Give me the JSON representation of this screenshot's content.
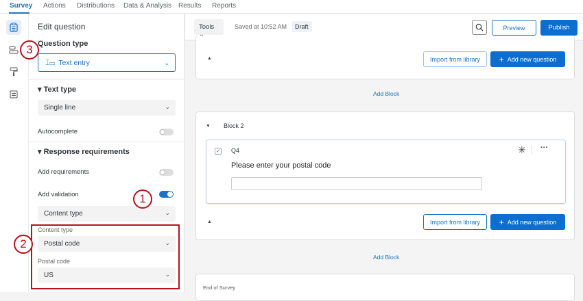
{
  "nav": {
    "tabs": [
      "Survey",
      "Actions",
      "Distributions",
      "Data & Analysis",
      "Results",
      "Reports"
    ]
  },
  "panel": {
    "title": "Edit question",
    "question_type_label": "Question type",
    "question_type_value": "Text entry",
    "text_type_label": "Text type",
    "text_type_value": "Single line",
    "autocomplete_label": "Autocomplete",
    "autocomplete_on": false,
    "response_requirements_label": "Response requirements",
    "add_requirements_label": "Add requirements",
    "add_requirements_on": false,
    "add_validation_label": "Add validation",
    "add_validation_on": true,
    "validation_select": "Content type",
    "content_type_label": "Content type",
    "content_type_value": "Postal code",
    "postal_code_label": "Postal code",
    "postal_code_value": "US"
  },
  "toolbar": {
    "tools": "Tools",
    "saved": "Saved at 10:52 AM",
    "status": "Draft",
    "preview": "Preview",
    "publish": "Publish"
  },
  "main": {
    "import_label": "Import from library",
    "add_question_label": "Add new question",
    "add_block_label": "Add Block",
    "block2_title": "Block 2",
    "question_id": "Q4",
    "question_text": "Please enter your postal code",
    "end_of_survey": "End of Survey"
  },
  "callouts": [
    "1",
    "2",
    "3"
  ],
  "colors": {
    "accent": "#1a73c8",
    "callout": "#b5121b"
  }
}
